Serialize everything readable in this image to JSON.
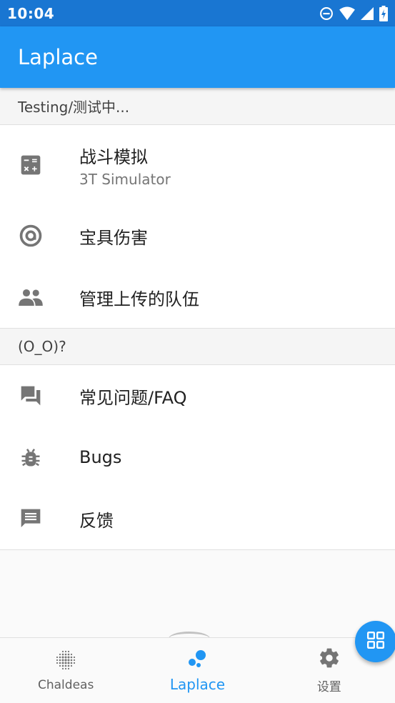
{
  "status_bar": {
    "time": "10:04",
    "icons": [
      "do-not-disturb-icon",
      "wifi-icon",
      "cell-signal-icon",
      "battery-charging-icon"
    ]
  },
  "app_bar": {
    "title": "Laplace"
  },
  "sections": [
    {
      "header": "Testing/测试中...",
      "items": [
        {
          "icon": "calculator-icon",
          "title": "战斗模拟",
          "subtitle": "3T Simulator"
        },
        {
          "icon": "at-sign-icon",
          "title": "宝具伤害"
        },
        {
          "icon": "people-icon",
          "title": "管理上传的队伍"
        }
      ]
    },
    {
      "header": "(O_O)?",
      "items": [
        {
          "icon": "forum-icon",
          "title": "常见问题/FAQ"
        },
        {
          "icon": "bug-icon",
          "title": "Bugs"
        },
        {
          "icon": "feedback-icon",
          "title": "反馈"
        }
      ]
    }
  ],
  "bottom_nav": {
    "items": [
      {
        "icon": "chaldeas-dots-icon",
        "label": "Chaldeas"
      },
      {
        "icon": "laplace-bubbles-icon",
        "label": "Laplace",
        "active": true
      },
      {
        "icon": "gear-icon",
        "label": "设置"
      }
    ]
  },
  "fab": {
    "icon": "grid-apps-icon"
  },
  "colors": {
    "status_bar": "#1976d2",
    "primary": "#2196f3",
    "icon_gray": "#757575",
    "text": "#212121"
  }
}
